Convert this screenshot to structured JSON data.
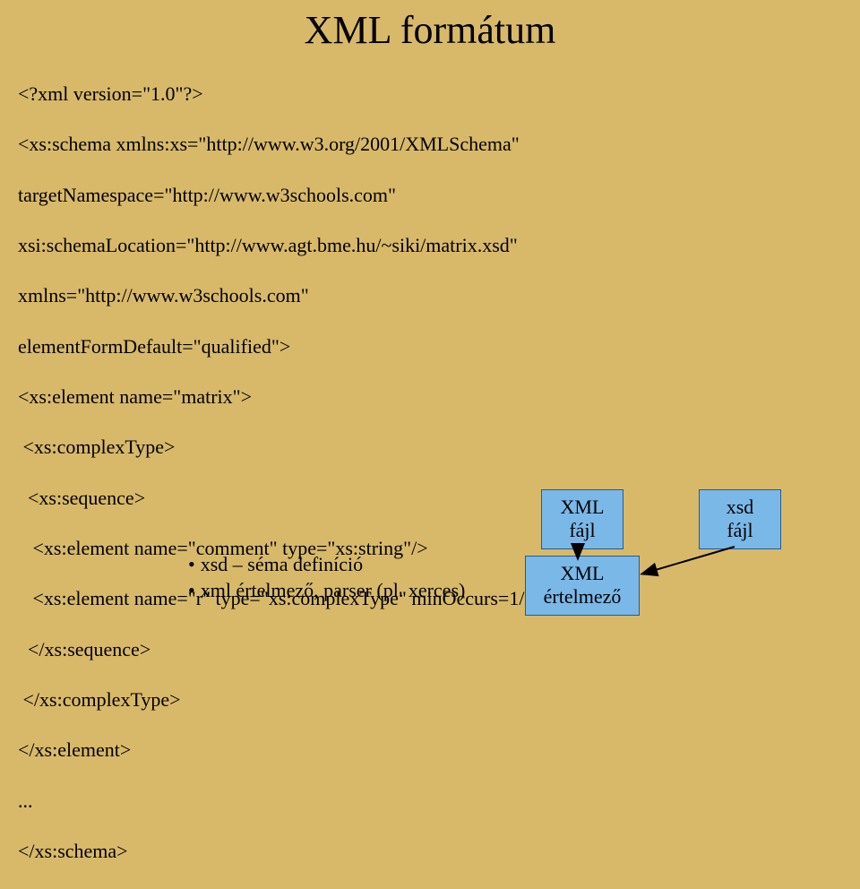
{
  "title": "XML formátum",
  "code": {
    "l1": "<?xml version=\"1.0\"?>",
    "l2": "<xs:schema xmlns:xs=\"http://www.w3.org/2001/XMLSchema\"",
    "l3": "targetNamespace=\"http://www.w3schools.com\"",
    "l4": "xsi:schemaLocation=\"http://www.agt.bme.hu/~siki/matrix.xsd\"",
    "l5": "xmlns=\"http://www.w3schools.com\"",
    "l6": "elementFormDefault=\"qualified\">",
    "l7": "<xs:element name=\"matrix\">",
    "l8": " <xs:complexType>",
    "l9": "  <xs:sequence>",
    "l10": "   <xs:element name=\"comment\" type=\"xs:string\"/>",
    "l11": "   <xs:element name=\"r\" type=\"xs:complexType\" minOccurs=1/>",
    "l12": "  </xs:sequence>",
    "l13": " </xs:complexType>",
    "l14": "</xs:element>",
    "l15": "...",
    "l16": "</xs:schema>"
  },
  "bullets": {
    "b1": "xsd – séma definíció",
    "b2": "xml értelmező, parser (pl. xerces)"
  },
  "boxes": {
    "xmlfile_line1": "XML",
    "xmlfile_line2": "fájl",
    "xsdfile_line1": "xsd",
    "xsdfile_line2": "fájl",
    "parser_line1": "XML",
    "parser_line2": "értelmező"
  }
}
